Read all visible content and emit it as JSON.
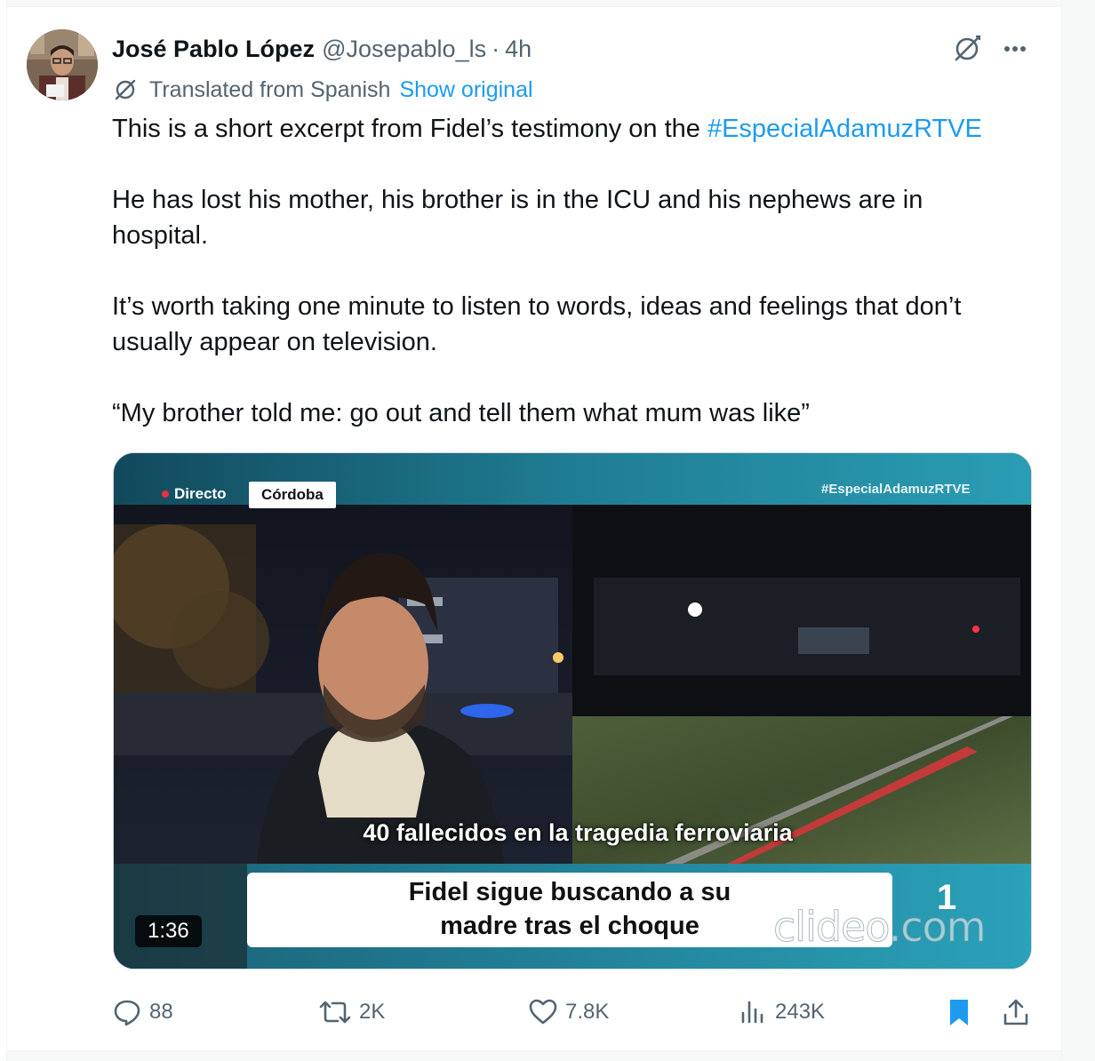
{
  "author": {
    "display_name": "José Pablo López",
    "handle": "@Josepablo_ls",
    "separator": "·",
    "time": "4h"
  },
  "header_actions": {
    "grok_icon": "grok-icon",
    "more_icon": "more-icon"
  },
  "translation": {
    "label": "Translated from Spanish",
    "show_original": "Show original"
  },
  "body": {
    "p1_text": "This is a short excerpt from Fidel’s testimony on the ",
    "p1_hashtag": "#EspecialAdamuzRTVE",
    "p2_line1": "He has lost his mother, his brother is in the ICU and his nephews are in",
    "p2_line2": "hospital.",
    "p3_line1": "It’s worth taking one minute to listen to words, ideas and feelings that don’t",
    "p3_line2": "usually appear on television.",
    "p4": "“My brother told me: go out and tell them what mum was like”"
  },
  "video": {
    "live_badge": "Directo",
    "location_badge": "Córdoba",
    "hashtag_overlay": "#EspecialAdamuzRTVE",
    "headline": "40 fallecidos en la tragedia ferroviaria",
    "caption_line1": "Fidel sigue buscando a su",
    "caption_line2": "madre tras el choque",
    "watermark": "clideo.com",
    "channel_logo": "1",
    "duration": "1:36"
  },
  "actions": {
    "replies": "88",
    "reposts": "2K",
    "likes": "7.8K",
    "views": "243K"
  },
  "colors": {
    "accent": "#1d9bf0",
    "secondary_text": "#536471",
    "text": "#0f1419"
  }
}
